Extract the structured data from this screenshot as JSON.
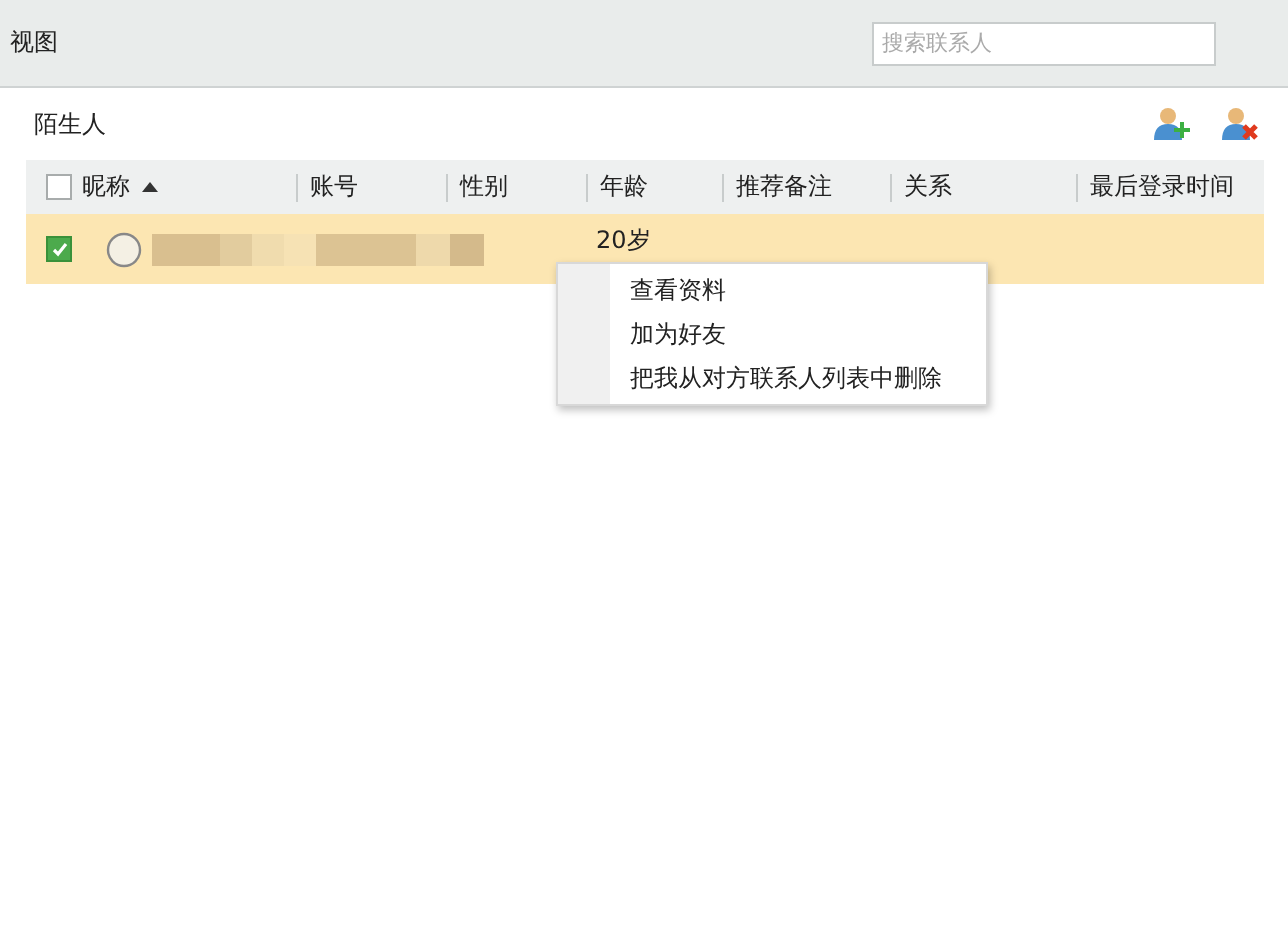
{
  "window": {
    "title": "视图"
  },
  "search": {
    "placeholder": "搜索联系人"
  },
  "group": {
    "title": "陌生人"
  },
  "table": {
    "select_all": {
      "checked": false
    },
    "columns": [
      {
        "label": "昵称",
        "sorted": true
      },
      {
        "label": "账号",
        "sorted": false
      },
      {
        "label": "性别",
        "sorted": false
      },
      {
        "label": "年龄",
        "sorted": false
      },
      {
        "label": "推荐备注",
        "sorted": false
      },
      {
        "label": "关系",
        "sorted": false
      },
      {
        "label": "最后登录时间",
        "sorted": false
      }
    ],
    "rows": [
      {
        "checked": true,
        "selected": true,
        "age": "20岁"
      }
    ]
  },
  "context_menu": {
    "items": [
      "查看资料",
      "加为好友",
      "把我从对方联系人列表中删除"
    ]
  }
}
